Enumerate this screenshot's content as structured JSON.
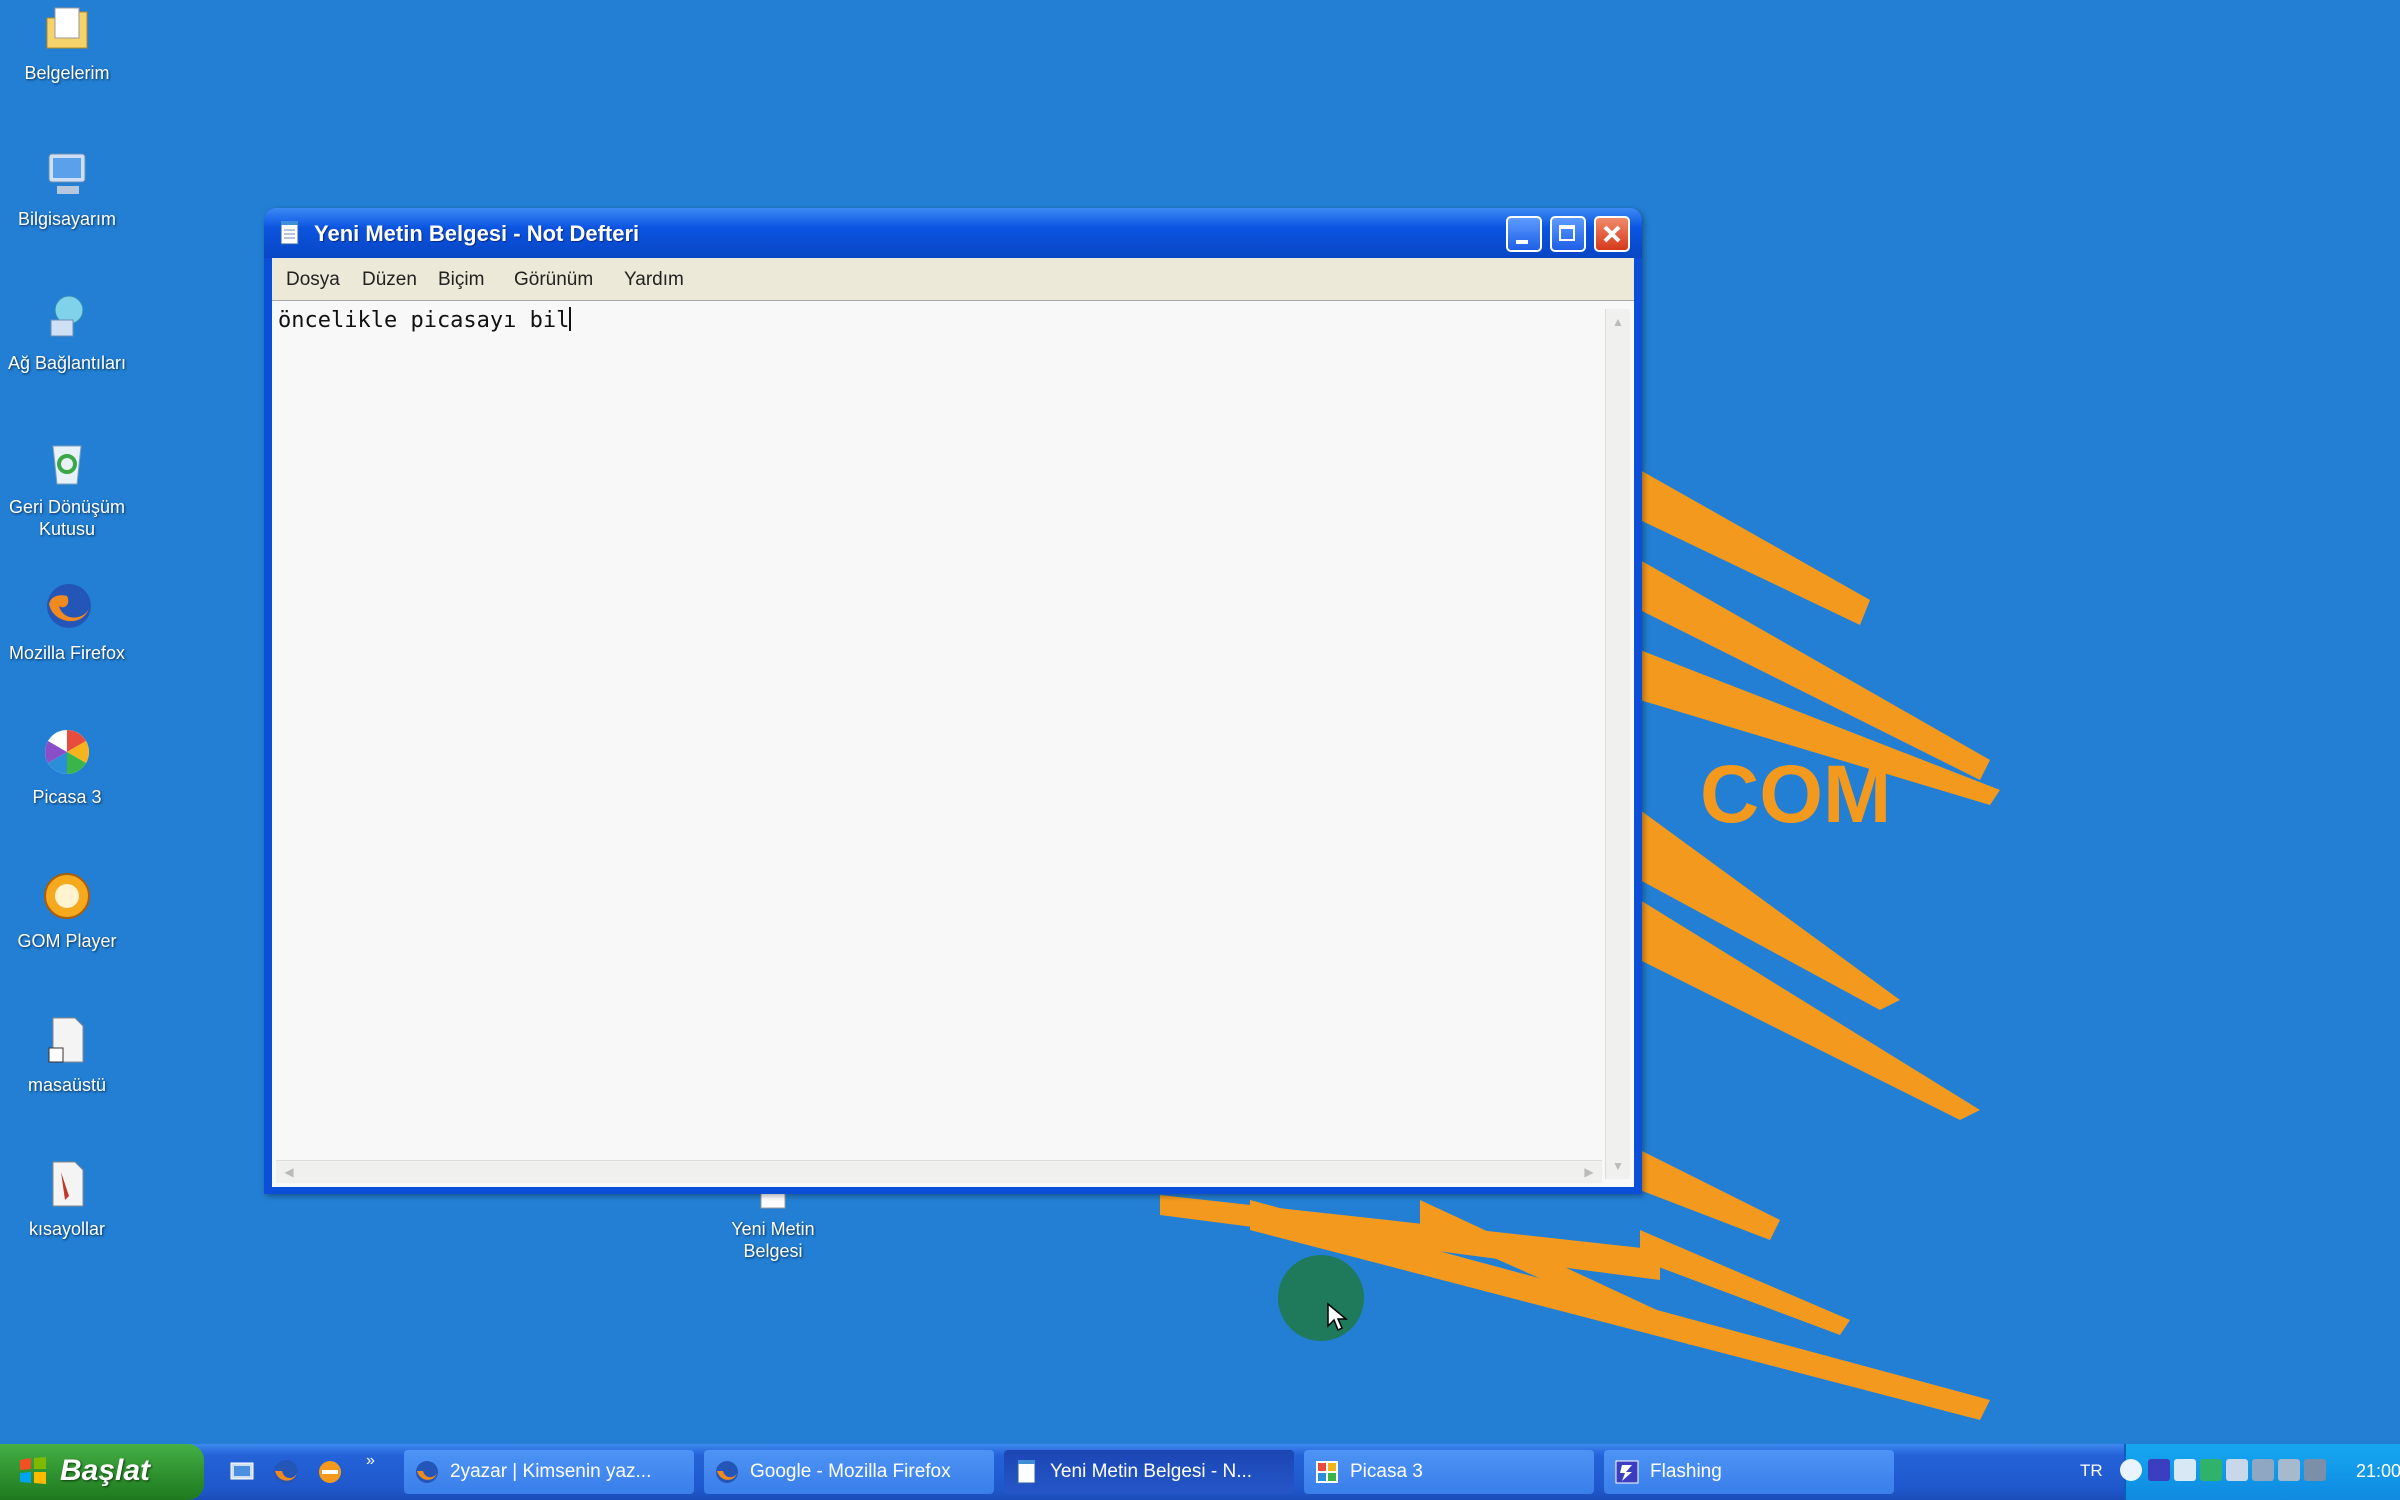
{
  "desktop": {
    "icons": [
      {
        "label": "Belgelerim",
        "icon": "folder-documents-icon"
      },
      {
        "label": "Bilgisayarım",
        "icon": "computer-icon"
      },
      {
        "label": "Ağ Bağlantıları",
        "icon": "network-icon"
      },
      {
        "label": "Geri Dönüşüm Kutusu",
        "icon": "recycle-bin-icon"
      },
      {
        "label": "Mozilla Firefox",
        "icon": "firefox-icon"
      },
      {
        "label": "Picasa 3",
        "icon": "picasa-icon"
      },
      {
        "label": "GOM Player",
        "icon": "gom-player-icon"
      },
      {
        "label": "masaüstü",
        "icon": "shortcut-file-icon"
      },
      {
        "label": "kısayollar",
        "icon": "shortcut-folder-icon"
      },
      {
        "label": "Yeni Metin Belgesi",
        "icon": "text-document-icon"
      }
    ],
    "wallpaper_text": "COM",
    "colors": {
      "background": "#237fd3",
      "splash": "#f39a1e"
    }
  },
  "notepad": {
    "title": "Yeni Metin Belgesi - Not Defteri",
    "menu": [
      "Dosya",
      "Düzen",
      "Biçim",
      "Görünüm",
      "Yardım"
    ],
    "content": "öncelikle picasayı bil"
  },
  "taskbar": {
    "start_label": "Başlat",
    "quick_launch": [
      "show-desktop-icon",
      "firefox-icon",
      "media-icon"
    ],
    "buttons": [
      {
        "label": "2yazar | Kimsenin yaz...",
        "icon": "firefox-icon",
        "active": false
      },
      {
        "label": "Google - Mozilla Firefox",
        "icon": "firefox-icon",
        "active": false
      },
      {
        "label": "Yeni Metin Belgesi - N...",
        "icon": "notepad-icon",
        "active": true
      },
      {
        "label": "Picasa 3",
        "icon": "picasa-icon",
        "active": false
      },
      {
        "label": "Flashing",
        "icon": "flashing-icon",
        "active": false
      }
    ],
    "tray": {
      "language": "TR",
      "clock": "21:00"
    }
  }
}
